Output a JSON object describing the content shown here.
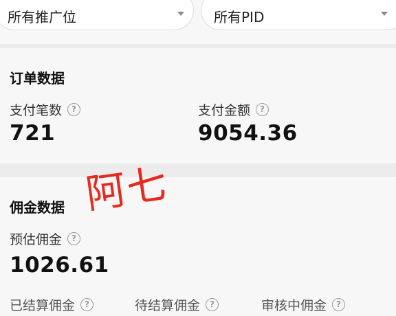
{
  "filters": {
    "ad_position": "所有推广位",
    "pid": "所有PID"
  },
  "order_data": {
    "title": "订单数据",
    "paid_count_label": "支付笔数",
    "paid_count_value": "721",
    "paid_amount_label": "支付金额",
    "paid_amount_value": "9054.36"
  },
  "commission_data": {
    "title": "佣金数据",
    "estimated_label": "预估佣金",
    "estimated_value": "1026.61",
    "settled_label": "已结算佣金",
    "pending_label": "待结算佣金",
    "reviewing_label": "审核中佣金"
  },
  "watermark": "阿七",
  "help_icon_glyph": "?",
  "colors": {
    "watermark": "#e52b1e"
  }
}
